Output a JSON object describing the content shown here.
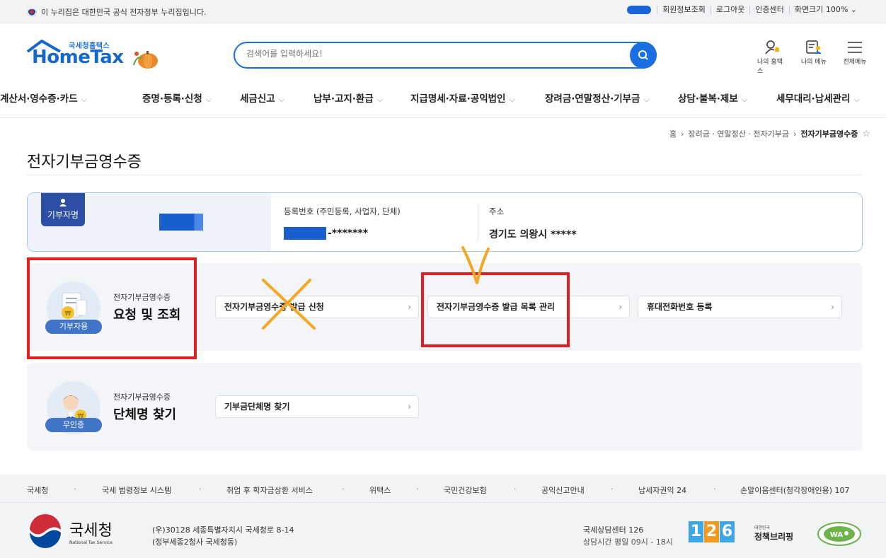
{
  "govbar": {
    "notice": "이 누리집은 대한민국 공식 전자정부 누리집입니다.",
    "links": [
      "회원정보조회",
      "로그아웃",
      "인증센터",
      "화면크기 100% ⌄"
    ]
  },
  "logo": {
    "small": "국세청홈택스",
    "big": "HomeTax"
  },
  "search": {
    "placeholder": "검색어를 입력하세요!"
  },
  "header_icons": [
    {
      "label": "나의 홈택스",
      "icon": "person-bell-icon"
    },
    {
      "label": "나의 메뉴",
      "icon": "list-person-icon"
    },
    {
      "label": "전체메뉴",
      "icon": "hamburger-icon"
    }
  ],
  "nav": [
    "계산서·영수증·카드",
    "증명·등록·신청",
    "세금신고",
    "납부·고지·환급",
    "지급명세·자료·공익법인",
    "장려금·연말정산·기부금",
    "상담·불복·제보",
    "세무대리·납세관리"
  ],
  "breadcrumb": {
    "home": "홈",
    "mid": "장려금 · 연말정산 · 전자기부금",
    "current": "전자기부금영수증"
  },
  "page_title": "전자기부금영수증",
  "info": {
    "badge": "기부자명",
    "reg_label": "등록번호 (주민등록, 사업자, 단체)",
    "reg_value": "-*******",
    "addr_label": "주소",
    "addr_value": "경기도 의왕시 *****"
  },
  "section1": {
    "tag": "기부자용",
    "sub": "전자기부금영수증",
    "title": "요청 및 조회",
    "links": [
      "전자기부금영수증 발급 신청",
      "전자기부금영수증 발급 목록 관리",
      "휴대전화번호 등록"
    ]
  },
  "section2": {
    "tag": "무인증",
    "sub": "전자기부금영수증",
    "title": "단체명 찾기",
    "links": [
      "기부금단체명 찾기"
    ]
  },
  "footer": {
    "links": [
      "국세청",
      "국세 법령정보 시스템",
      "취업 후 학자금상환 서비스",
      "위택스",
      "국민건강보험",
      "공익신고안내",
      "납세자권익 24",
      "손말이음센터(청각장애인용) 107"
    ],
    "org": "국세청",
    "org_en": "National Tax Service",
    "addr1": "(우)30128 세종특별자치시 국세청로 8-14",
    "addr2": "(정부세종2청사 국세청동)",
    "center1": "국세상담센터 126",
    "center2": "상담시간 평일 09시 - 18시",
    "badge_digits": [
      "1",
      "2",
      "6"
    ],
    "brief_small": "대한민국",
    "brief": "정책브리핑"
  },
  "colors": {
    "brand": "#1a6fe0",
    "annotation_red": "#e02020",
    "annotation_orange": "#f5a623"
  }
}
